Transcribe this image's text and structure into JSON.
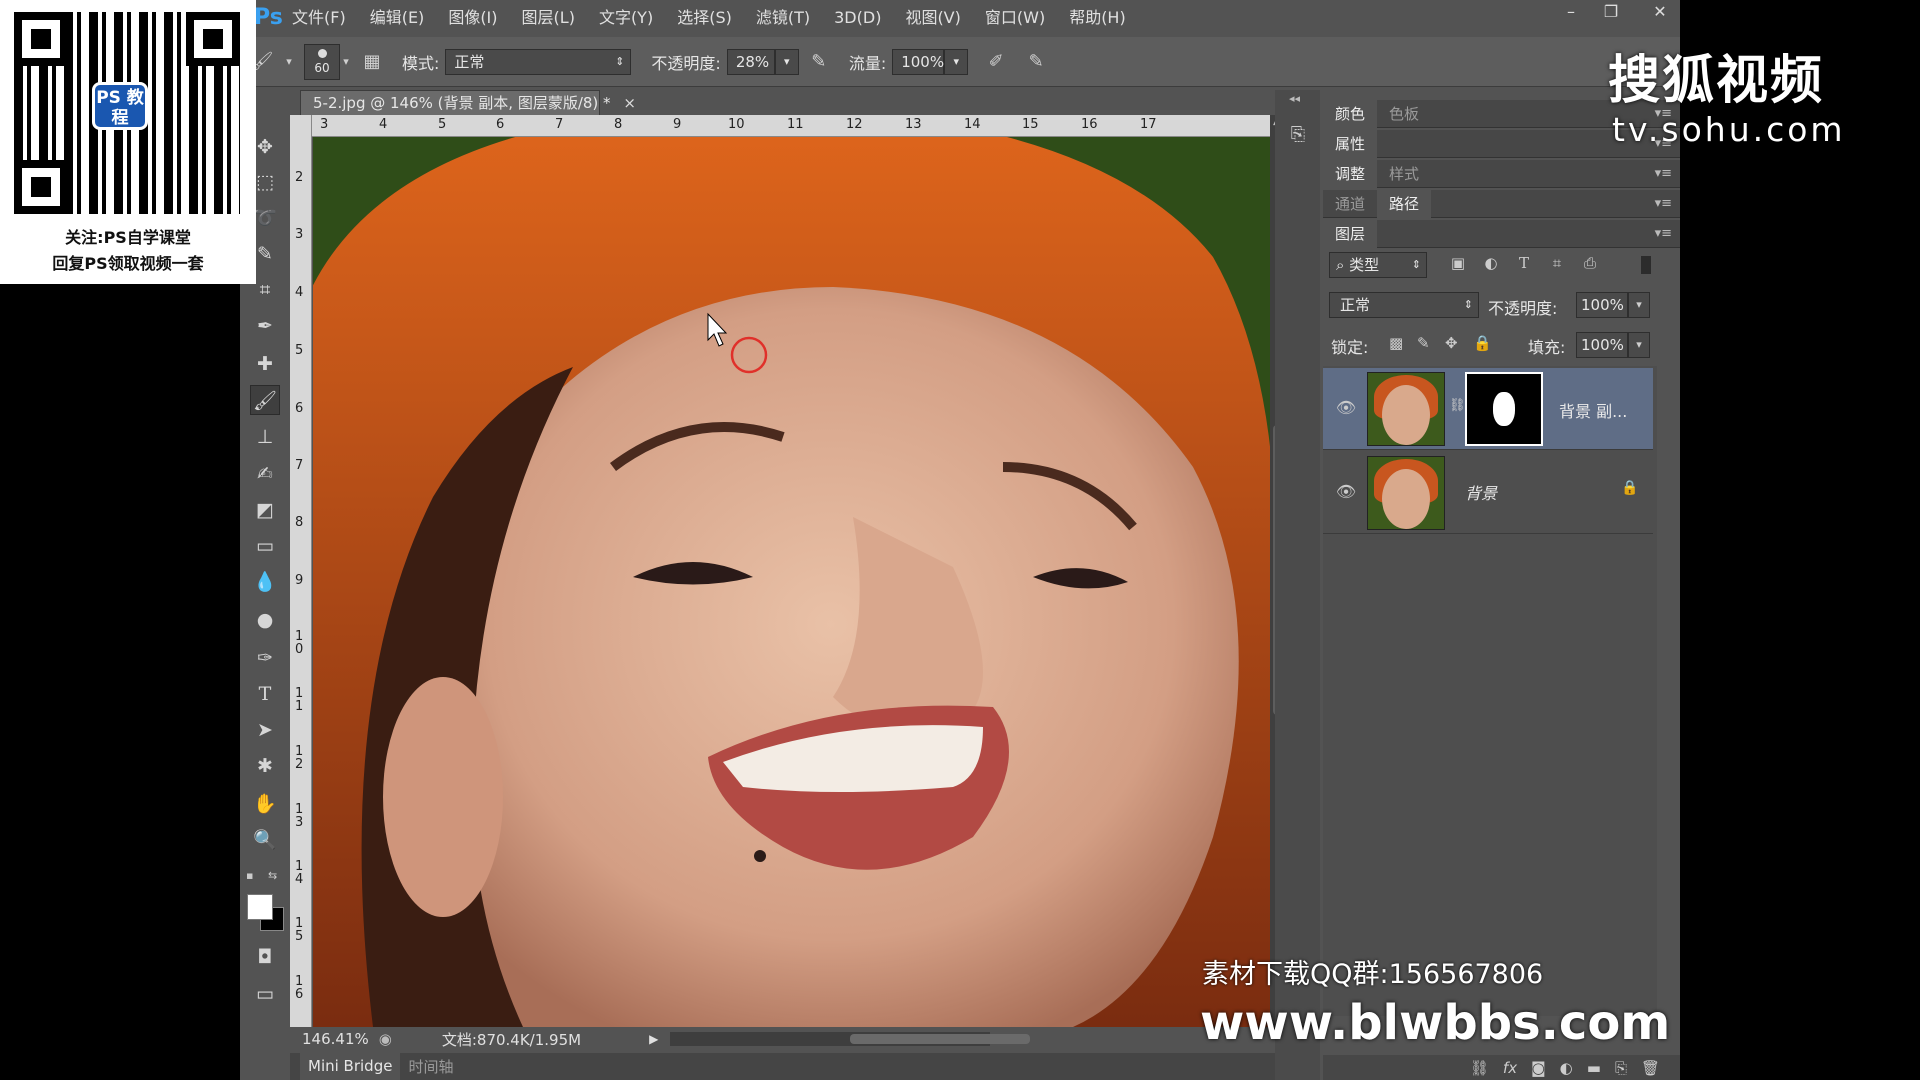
{
  "app": {
    "logo": "Ps"
  },
  "menu": [
    "文件(F)",
    "编辑(E)",
    "图像(I)",
    "图层(L)",
    "文字(Y)",
    "选择(S)",
    "滤镜(T)",
    "3D(D)",
    "视图(V)",
    "窗口(W)",
    "帮助(H)"
  ],
  "window_controls": {
    "minimize": "–",
    "restore": "❐",
    "close": "✕"
  },
  "options": {
    "brush_size": "60",
    "mode_label": "模式:",
    "mode_value": "正常",
    "opacity_label": "不透明度:",
    "opacity_value": "28%",
    "flow_label": "流量:",
    "flow_value": "100%"
  },
  "document": {
    "tab_title": "5-2.jpg @ 146% (背景 副本, 图层蒙版/8) *",
    "tab_close": "×"
  },
  "ruler": {
    "top": [
      "3",
      "4",
      "5",
      "6",
      "7",
      "8",
      "9",
      "10",
      "11",
      "12",
      "13",
      "14",
      "15",
      "16",
      "17"
    ],
    "left": [
      "2",
      "3",
      "4",
      "5",
      "6",
      "7",
      "8",
      "9",
      "1 0",
      "1 1",
      "1 2",
      "1 3",
      "1 4",
      "1 5",
      "1 6"
    ]
  },
  "status": {
    "zoom": "146.41%",
    "doc_info": "文档:870.4K/1.95M"
  },
  "bottom_tabs": [
    "Mini Bridge",
    "时间轴"
  ],
  "panels": {
    "row1": [
      "颜色",
      "色板"
    ],
    "row2": [
      "属性"
    ],
    "row3": [
      "调整",
      "样式"
    ],
    "row4": [
      "通道",
      "路径"
    ],
    "row5": [
      "图层"
    ],
    "filter_kind": "类型",
    "blend_mode": "正常",
    "opacity_label": "不透明度:",
    "opacity_value": "100%",
    "lock_label": "锁定:",
    "fill_label": "填充:",
    "fill_value": "100%",
    "layers": [
      {
        "name": "背景 副...",
        "has_mask": true
      },
      {
        "name": "背景",
        "locked": true
      }
    ],
    "footer_icons": [
      "link-icon",
      "fx-icon",
      "mask-icon",
      "adjustment-icon",
      "folder-icon",
      "new-layer-icon",
      "trash-icon"
    ]
  },
  "overlays": {
    "qr_badge": "PS 教程",
    "qr_caption_1": "关注:PS自学课堂",
    "qr_caption_2": "回复PS领取视频一套",
    "sohu_logo": "搜狐视频",
    "sohu_url": "tv.sohu.com",
    "watermark_qq": "素材下载QQ群:156567806",
    "watermark_site": "www.blwbbs.com"
  },
  "colors": {
    "ui_bg": "#535353",
    "brush_cursor": "#e0302a",
    "hair": "#c8561f"
  }
}
